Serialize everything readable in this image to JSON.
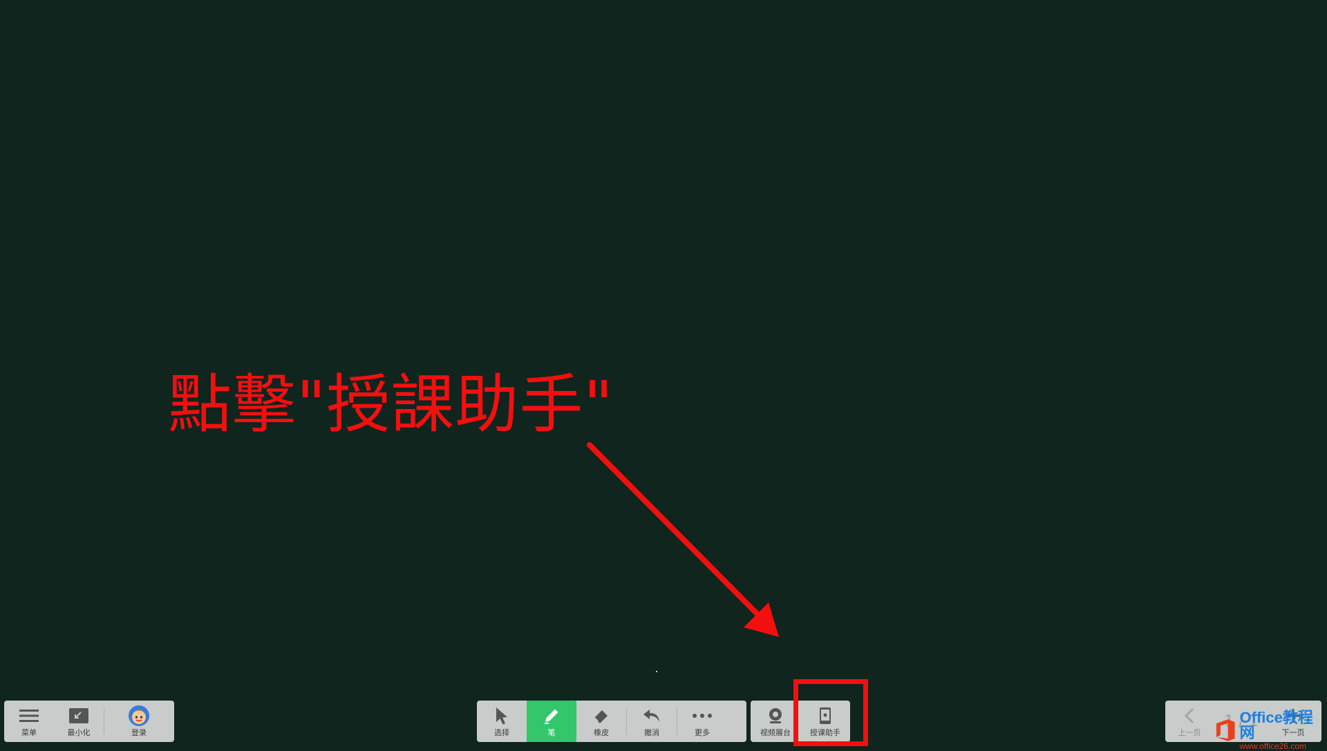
{
  "annotation": {
    "text": "點擊\"授課助手\"",
    "color": "#f40f0f"
  },
  "toolbar_left": {
    "menu_label": "菜单",
    "minimize_label": "最小化",
    "login_label": "登录"
  },
  "toolbar_mid": {
    "select_label": "选择",
    "pen_label": "笔",
    "eraser_label": "橡皮",
    "undo_label": "撤消",
    "more_label": "更多"
  },
  "toolbar_media": {
    "video_label": "视频展台",
    "assistant_label": "授课助手"
  },
  "toolbar_right": {
    "prev_label": "上一页",
    "page_indicator": "1 / 1",
    "next_label": "下一页"
  },
  "watermark": {
    "line1": "Office教程网",
    "line2": "www.office26.com"
  },
  "colors": {
    "background": "#10251e",
    "toolbar": "#c8ccca",
    "active": "#33c66b",
    "highlight": "#f40f0f"
  }
}
